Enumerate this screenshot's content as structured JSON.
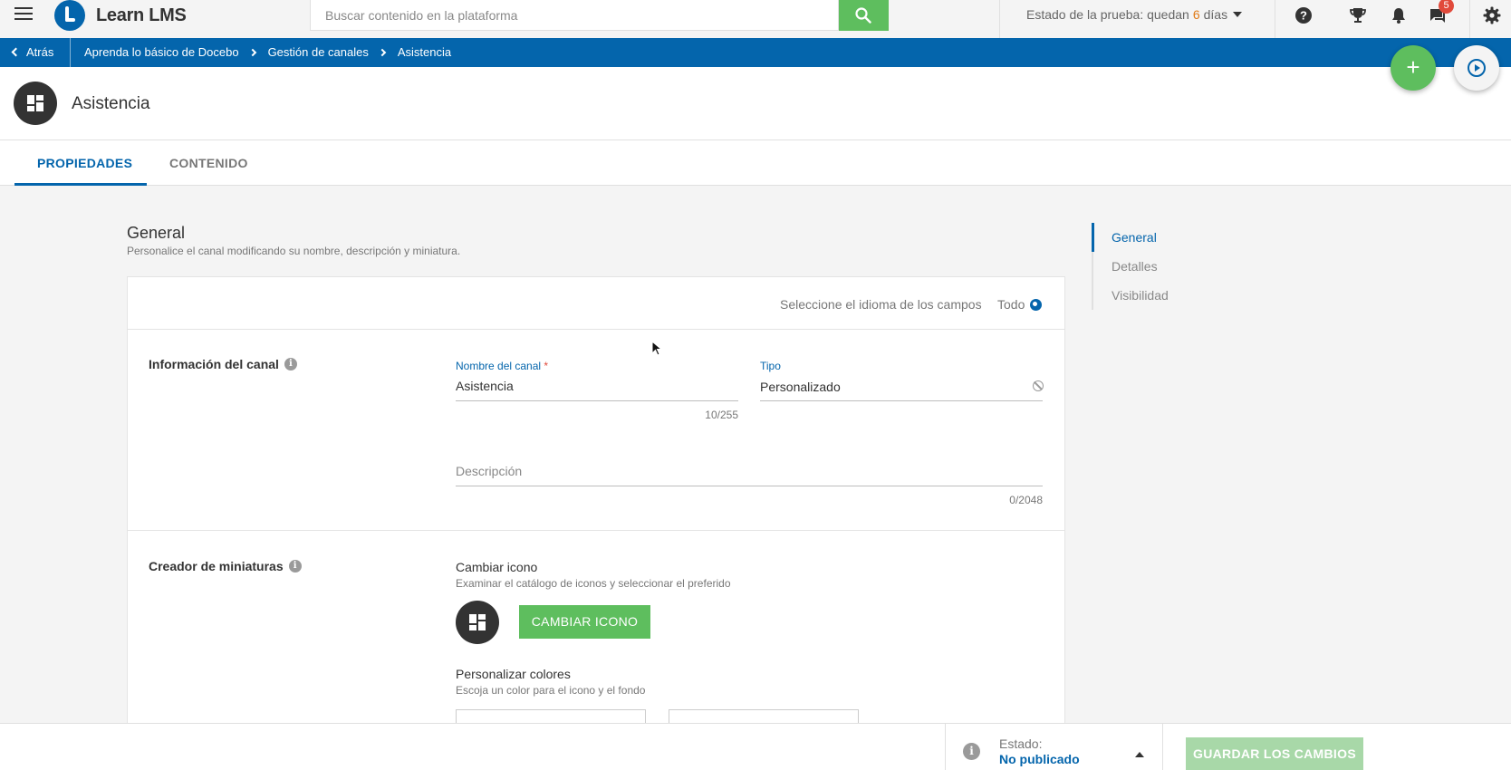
{
  "topbar": {
    "logo_text": "Learn LMS",
    "search_placeholder": "Buscar contenido en la plataforma",
    "trial_prefix": "Estado de la prueba: quedan",
    "trial_days": "6",
    "trial_suffix": "días",
    "notifications_count": "5",
    "icons": [
      "menu-icon",
      "search-icon",
      "help-icon",
      "trophy-icon",
      "bell-icon",
      "chat-icon",
      "gear-icon"
    ]
  },
  "breadcrumb": {
    "back_label": "Atrás",
    "items": [
      "Aprenda lo básico de Docebo",
      "Gestión de canales",
      "Asistencia"
    ]
  },
  "header": {
    "title": "Asistencia"
  },
  "tabs": [
    {
      "label": "PROPIEDADES",
      "active": true
    },
    {
      "label": "CONTENIDO",
      "active": false
    }
  ],
  "section": {
    "title": "General",
    "description": "Personalice el canal modificando su nombre, descripción y miniatura."
  },
  "card": {
    "language_label": "Seleccione el idioma de los campos",
    "language_value": "Todo",
    "channel_info": {
      "title": "Información del canal",
      "name_label": "Nombre del canal",
      "name_required": "*",
      "name_value": "Asistencia",
      "name_counter": "10/255",
      "type_label": "Tipo",
      "type_value": "Personalizado",
      "description_placeholder": "Descripción",
      "description_counter": "0/2048"
    },
    "thumbnail": {
      "title": "Creador de miniaturas",
      "change_icon_title": "Cambiar icono",
      "change_icon_desc": "Examinar el catálogo de iconos y seleccionar el preferido",
      "change_icon_button": "CAMBIAR ICONO",
      "colors_title": "Personalizar colores",
      "colors_desc": "Escoja un color para el icono y el fondo"
    }
  },
  "right_nav": [
    {
      "label": "General",
      "active": true
    },
    {
      "label": "Detalles",
      "active": false
    },
    {
      "label": "Visibilidad",
      "active": false
    }
  ],
  "footer": {
    "state_label": "Estado:",
    "state_value": "No publicado",
    "save_button": "GUARDAR LOS CAMBIOS"
  },
  "colors": {
    "primary": "#0465ac",
    "green": "#5ebe5e",
    "green_disabled": "#a8d8a8",
    "orange": "#e07a16",
    "badge_red": "#e14a3b"
  }
}
